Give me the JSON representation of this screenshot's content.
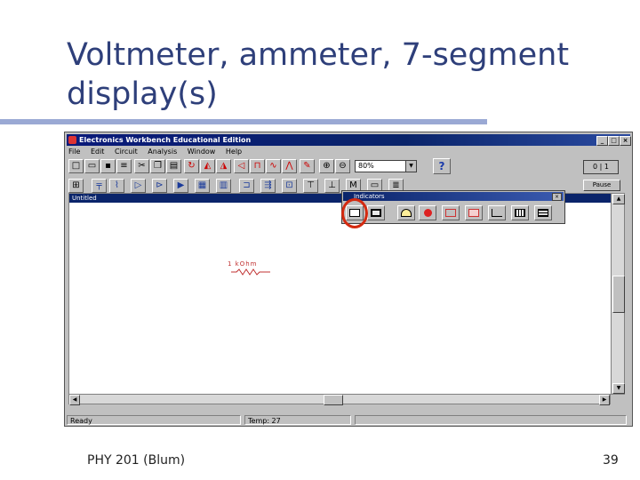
{
  "slide": {
    "title_line1": "Voltmeter, ammeter, 7-segment",
    "title_line2": "display(s)",
    "footer_left": "PHY 201 (Blum)",
    "page_number": "39"
  },
  "window": {
    "title": "Electronics Workbench Educational Edition",
    "min_label": "_",
    "max_label": "□",
    "close_label": "×"
  },
  "menu": [
    "File",
    "Edit",
    "Circuit",
    "Analysis",
    "Window",
    "Help"
  ],
  "toolbar": {
    "zoom_value": "80%",
    "help_label": "?",
    "power_label": "0 | 1",
    "pause_label": "Pause"
  },
  "document": {
    "title": "Untitled"
  },
  "circuit": {
    "resistor_label": "1 kOhm"
  },
  "palette": {
    "title": "Indicators",
    "close_label": "×"
  },
  "status": {
    "ready": "Ready",
    "temp": "Temp: 27"
  },
  "colors": {
    "accent": "#2e3f7a",
    "rule": "#9aa9d4",
    "highlight": "#d42a10",
    "titlebar": "#0a246a"
  }
}
